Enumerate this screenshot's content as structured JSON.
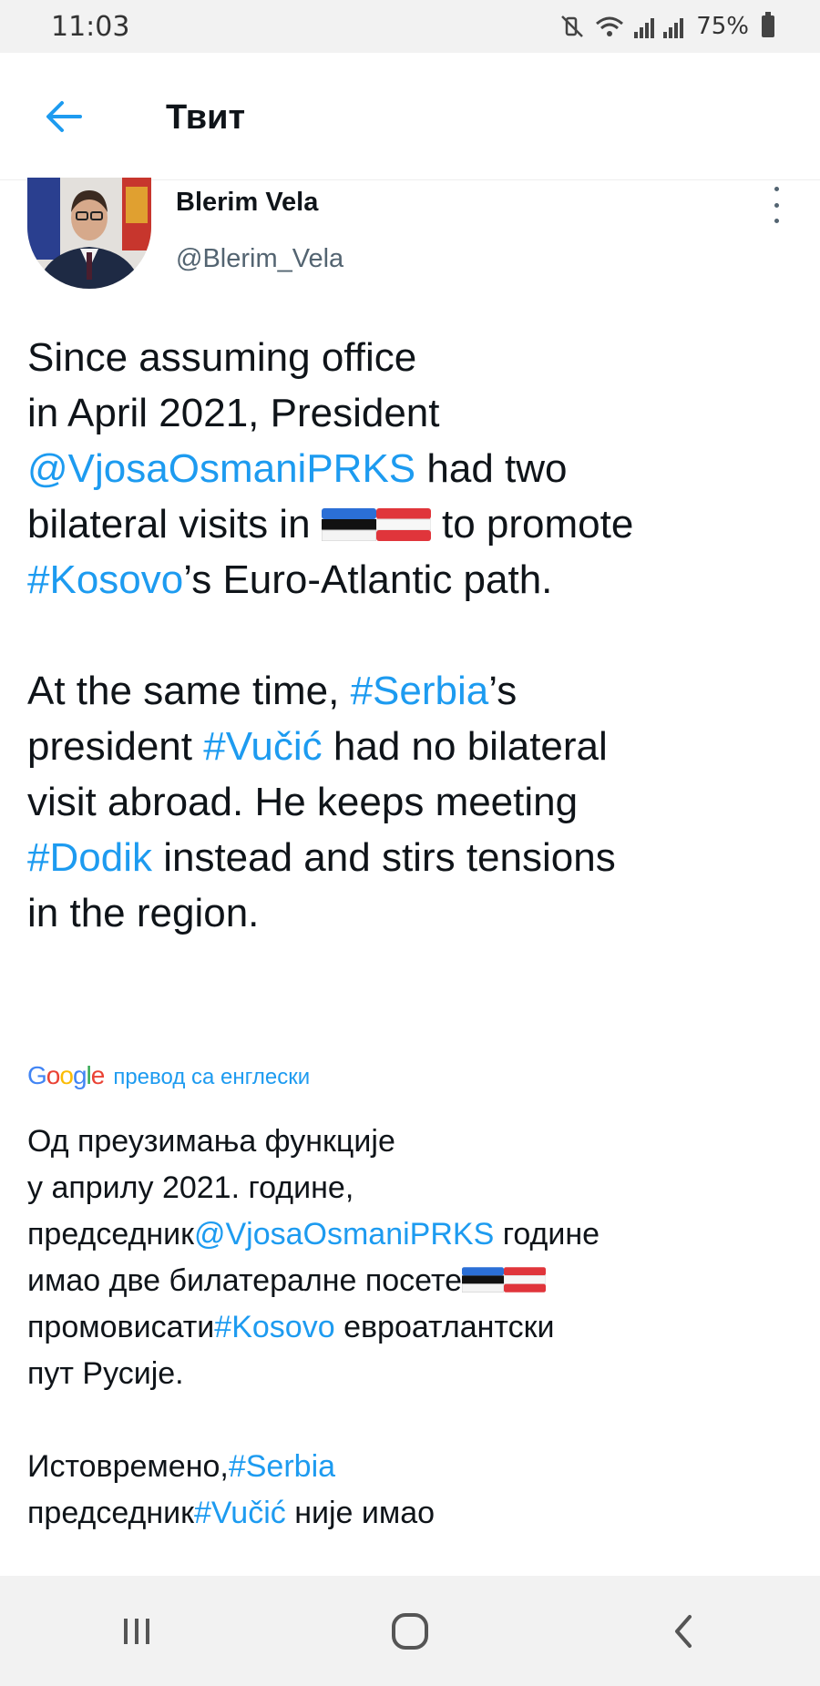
{
  "status_bar": {
    "time": "11:03",
    "battery": "75%"
  },
  "header": {
    "title": "Твит"
  },
  "tweet": {
    "author_name": "Blerim Vela",
    "author_handle": "@Blerim_Vela",
    "text_lines": {
      "l1": "Since assuming office",
      "l2": "in April 2021, President",
      "l3_link": "@VjosaOsmaniPRKS",
      "l3_rest": " had two",
      "l4_start": "bilateral visits in ",
      "l4_end": " to promote",
      "l5_link": "#Kosovo",
      "l5_rest": "’s Euro-Atlantic path.",
      "l6_start": "At the same time, ",
      "l6_link": "#Serbia",
      "l6_rest": "’s",
      "l7_start": "president ",
      "l7_link": "#Vučić",
      "l7_rest": " had no bilateral",
      "l8": "visit abroad. He keeps meeting",
      "l9_link": "#Dodik",
      "l9_rest": " instead and stirs tensions",
      "l10": "in the region."
    },
    "flags": [
      "estonia-flag",
      "austria-flag"
    ]
  },
  "translation": {
    "google_logo": "Google",
    "label": "превод са енглески",
    "lines": {
      "t1": "Од преузимања функције",
      "t2": "у априлу 2021. године,",
      "t3_start": "председник",
      "t3_link": "@VjosaOsmaniPRKS",
      "t3_rest": " године",
      "t4": "имао две билатералне посете",
      "t5_start": "промовисати",
      "t5_link": "#Kosovo",
      "t5_rest": " евроатлантски",
      "t6": "пут Русије.",
      "t7_start": " Истовремено,",
      "t7_link": "#Serbia",
      "t8_start": "председник",
      "t8_link": "#Vučić",
      "t8_rest": " није имао"
    }
  },
  "colors": {
    "link": "#1d9bf0",
    "text": "#0f1419",
    "secondary": "#536471"
  }
}
